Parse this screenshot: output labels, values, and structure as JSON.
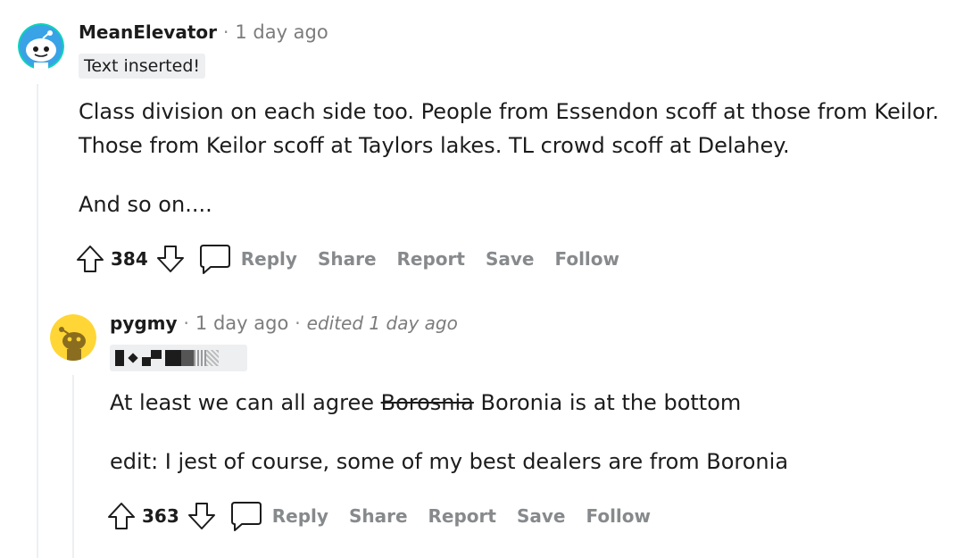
{
  "comments": [
    {
      "username": "MeanElevator",
      "time": "1 day ago",
      "flair": "Text inserted!",
      "paragraphs": [
        "Class division on each side too. People from Essendon scoff at those from Keilor.",
        "Those from Keilor scoff at Taylors lakes. TL crowd scoff at Delahey.",
        "And so on...."
      ],
      "votes": "384",
      "actions": {
        "reply": "Reply",
        "share": "Share",
        "report": "Report",
        "save": "Save",
        "follow": "Follow"
      }
    },
    {
      "username": "pygmy",
      "time": "1 day ago",
      "edited": "edited 1 day ago",
      "paragraphs": {
        "line1_before": "At least we can all agree ",
        "line1_strike": "Borosnia",
        "line1_after": " Boronia is at the bottom",
        "line2": "edit: I jest of course, some of my best dealers are from Boronia"
      },
      "votes": "363",
      "actions": {
        "reply": "Reply",
        "share": "Share",
        "report": "Report",
        "save": "Save",
        "follow": "Follow"
      }
    }
  ],
  "separator": "·",
  "colors": {
    "text": "#1c1c1c",
    "muted": "#878a8c",
    "flair_bg": "#edeff1",
    "thread_line": "#edeff1",
    "avatar1_bg": "#0dd3bb",
    "avatar2_bg": "#ffd635"
  },
  "icons": [
    "upvote-icon",
    "downvote-icon",
    "comment-icon",
    "snoo-avatar-icon"
  ]
}
